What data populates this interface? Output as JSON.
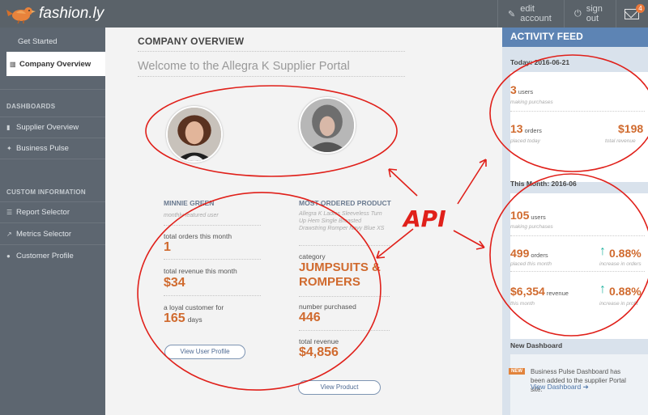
{
  "app": {
    "brand": "fashion.ly"
  },
  "header": {
    "edit_account": "edit account",
    "sign_out": "sign out",
    "mail_count": "4"
  },
  "sidebar": {
    "get_started": "Get Started",
    "company_overview": "Company Overview",
    "dashboards_heading": "DASHBOARDS",
    "supplier_overview": "Supplier Overview",
    "business_pulse": "Business Pulse",
    "custom_heading": "CUSTOM INFORMATION",
    "report_selector": "Report Selector",
    "metrics_selector": "Metrics Selector",
    "customer_profile": "Customer Profile"
  },
  "main": {
    "title": "COMPANY OVERVIEW",
    "welcome": "Welcome to the Allegra K Supplier Portal",
    "featured": {
      "name": "MINNIE GREEN",
      "subtitle": "monthly featured user",
      "orders_label": "total orders this month",
      "orders_value": "1",
      "revenue_label": "total revenue this month",
      "revenue_value": "$34",
      "loyal_label": "a loyal customer for",
      "loyal_value": "165",
      "loyal_unit": "days",
      "button": "View User Profile"
    },
    "product": {
      "heading": "MOST ORDERED PRODUCT",
      "description": "Allegra K Ladies Sleeveless Turn Up Hem Single Breasted Drawstring Romper Navy Blue XS",
      "category_label": "category",
      "category_value": "JUMPSUITS & ROMPERS",
      "purchased_label": "number purchased",
      "purchased_value": "446",
      "revenue_label": "total revenue",
      "revenue_value": "$4,856",
      "button": "View Product"
    }
  },
  "feed": {
    "title": "ACTIVITY FEED",
    "today_label": "Today: 2016-06-21",
    "today": {
      "users_value": "3",
      "users_unit": "users",
      "users_sub": "making purchases",
      "orders_value": "13",
      "orders_unit": "orders",
      "orders_sub": "placed today",
      "revenue_value": "$198",
      "revenue_sub": "total revenue"
    },
    "month_label": "This Month: 2016-06",
    "month": {
      "users_value": "105",
      "users_unit": "users",
      "users_sub": "making purchases",
      "orders_value": "499",
      "orders_unit": "orders",
      "orders_sub": "placed this month",
      "orders_pct": "0.88%",
      "orders_pct_sub": "increase in orders",
      "revenue_value": "$6,354",
      "revenue_unit": "revenue",
      "revenue_sub": "this month",
      "revenue_pct": "0.88%",
      "revenue_pct_sub": "increase in profit"
    },
    "new_dashboard": {
      "heading": "New Dashboard",
      "tag": "NEW",
      "text": "Business Pulse Dashboard has been added to the supplier Portal site.",
      "link": "View Dashboard"
    }
  },
  "annotation": {
    "label": "API",
    "color": "#e0201a"
  },
  "colors": {
    "accent": "#d06a2e",
    "sidebar": "#5d6670",
    "feed_header": "#5d84b4",
    "teal": "#27b5a2"
  }
}
